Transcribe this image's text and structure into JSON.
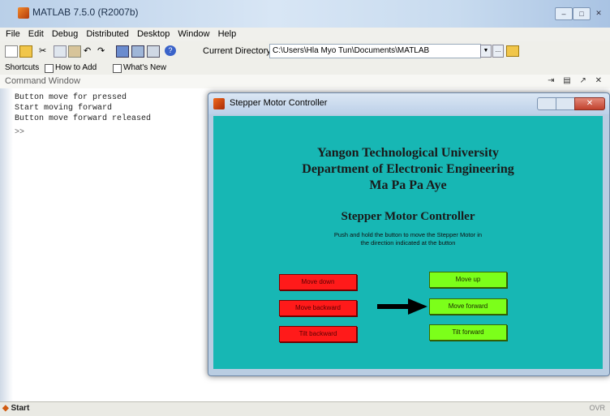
{
  "window": {
    "title": "MATLAB 7.5.0 (R2007b)"
  },
  "menu": [
    "File",
    "Edit",
    "Debug",
    "Distributed",
    "Desktop",
    "Window",
    "Help"
  ],
  "toolbar": {
    "current_directory_label": "Current Directory:",
    "current_directory_value": "C:\\Users\\Hla Myo Tun\\Documents\\MATLAB"
  },
  "shortcuts": {
    "label": "Shortcuts",
    "how_to_add": "How to Add",
    "whats_new": "What's New"
  },
  "command_window": {
    "title": "Command Window",
    "lines": [
      "Button move for pressed",
      "Start moving forward",
      "Button move forward released",
      ">>"
    ]
  },
  "statusbar": {
    "start": "Start",
    "ovr": "OVR"
  },
  "gui": {
    "title": "Stepper Motor Controller",
    "heading_lines": [
      "Yangon Technological University",
      "Department of Electronic Engineering",
      "Ma Pa Pa Aye"
    ],
    "subtitle": "Stepper Motor Controller",
    "instructions": [
      "Push and hold the button to move the Stepper Motor in",
      "the direction indicated at the button"
    ],
    "buttons": {
      "move_down": "Move down",
      "move_backward": "Move backward",
      "tilt_backward": "Tilt backward",
      "move_up": "Move up",
      "move_forward": "Move forward",
      "tilt_forward": "Tilt forward"
    }
  },
  "colors": {
    "panel": "#17b7b4",
    "red_button": "#ff1a1a",
    "green_button": "#7cff1a"
  }
}
